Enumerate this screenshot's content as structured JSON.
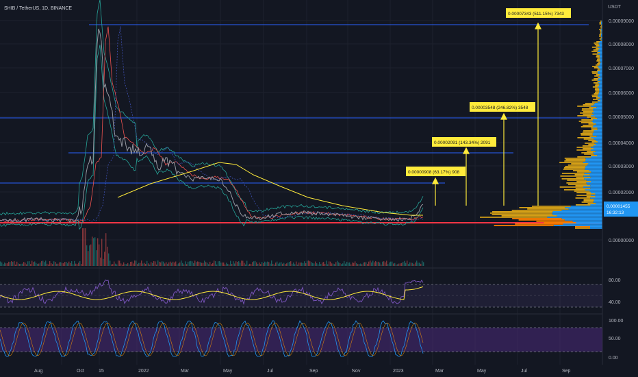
{
  "header": {
    "title": "SHIB / TetherUS, 1D, BINANCE",
    "currency": "USDT"
  },
  "price_axis": {
    "ticks": [
      "0.00009000",
      "0.00008000",
      "0.00007000",
      "0.00006000",
      "0.00005000",
      "0.00004000",
      "0.00003000",
      "0.00002000",
      "0.00000000"
    ],
    "current_price": "0.00001455",
    "countdown": "16:32:13"
  },
  "time_axis": {
    "ticks": [
      "Aug",
      "Oct",
      "15",
      "2022",
      "Mar",
      "May",
      "Jul",
      "Sep",
      "Nov",
      "2023",
      "Mar",
      "May",
      "Jul",
      "Sep"
    ]
  },
  "targets": [
    {
      "label": "0.00000908 (63.17%) 908",
      "color": "#ffeb3b"
    },
    {
      "label": "0.00002091 (143.34%) 2091",
      "color": "#ffeb3b"
    },
    {
      "label": "0.00003548 (246.82%) 3548",
      "color": "#ffeb3b"
    },
    {
      "label": "0.00007343 (511.15%) 7343",
      "color": "#ffeb3b"
    }
  ],
  "rsi_panel": {
    "ticks": [
      "80.00",
      "40.00"
    ]
  },
  "stoch_panel": {
    "ticks": [
      "100.00",
      "50.00",
      "0.00"
    ]
  },
  "colors": {
    "background": "#131722",
    "level_line": "#2962ff",
    "support_line": "#f23645",
    "price_label_bg": "#2196f3",
    "volume_profile_up": "#2196f3",
    "volume_profile_down": "#d4a017",
    "rsi_line": "#7e57c2",
    "rsi_ma": "#ffeb3b",
    "stoch_band": "#4a2a7a"
  },
  "chart_data": {
    "type": "line",
    "title": "SHIB / TetherUS, 1D, BINANCE",
    "ylabel": "USDT",
    "ylim": [
      0,
      9e-05
    ],
    "horizontal_levels": [
      8.85e-05,
      4.95e-05,
      3.53e-05,
      2.44e-05
    ],
    "support_level": 7.2e-06,
    "targets": [
      9.08e-06,
      2.091e-05,
      3.548e-05,
      7.343e-05
    ],
    "targets_pct": [
      63.17,
      143.34,
      246.82,
      511.15
    ],
    "current_price": 1.455e-05,
    "x": [
      "Aug",
      "Oct",
      "15",
      "2022",
      "Mar",
      "May",
      "Jul",
      "Sep",
      "Nov",
      "2023"
    ],
    "series": [
      {
        "values": [
          7.5e-06,
          8.2e-06,
          8.5e-05,
          3.6e-05,
          2.6e-05,
          2.7e-05,
          1.1e-05,
          1.3e-05,
          1e-05,
          1.25e-05
        ]
      }
    ],
    "rsi_ticks": [
      80,
      40
    ],
    "stoch_ticks": [
      100,
      50,
      0
    ]
  }
}
